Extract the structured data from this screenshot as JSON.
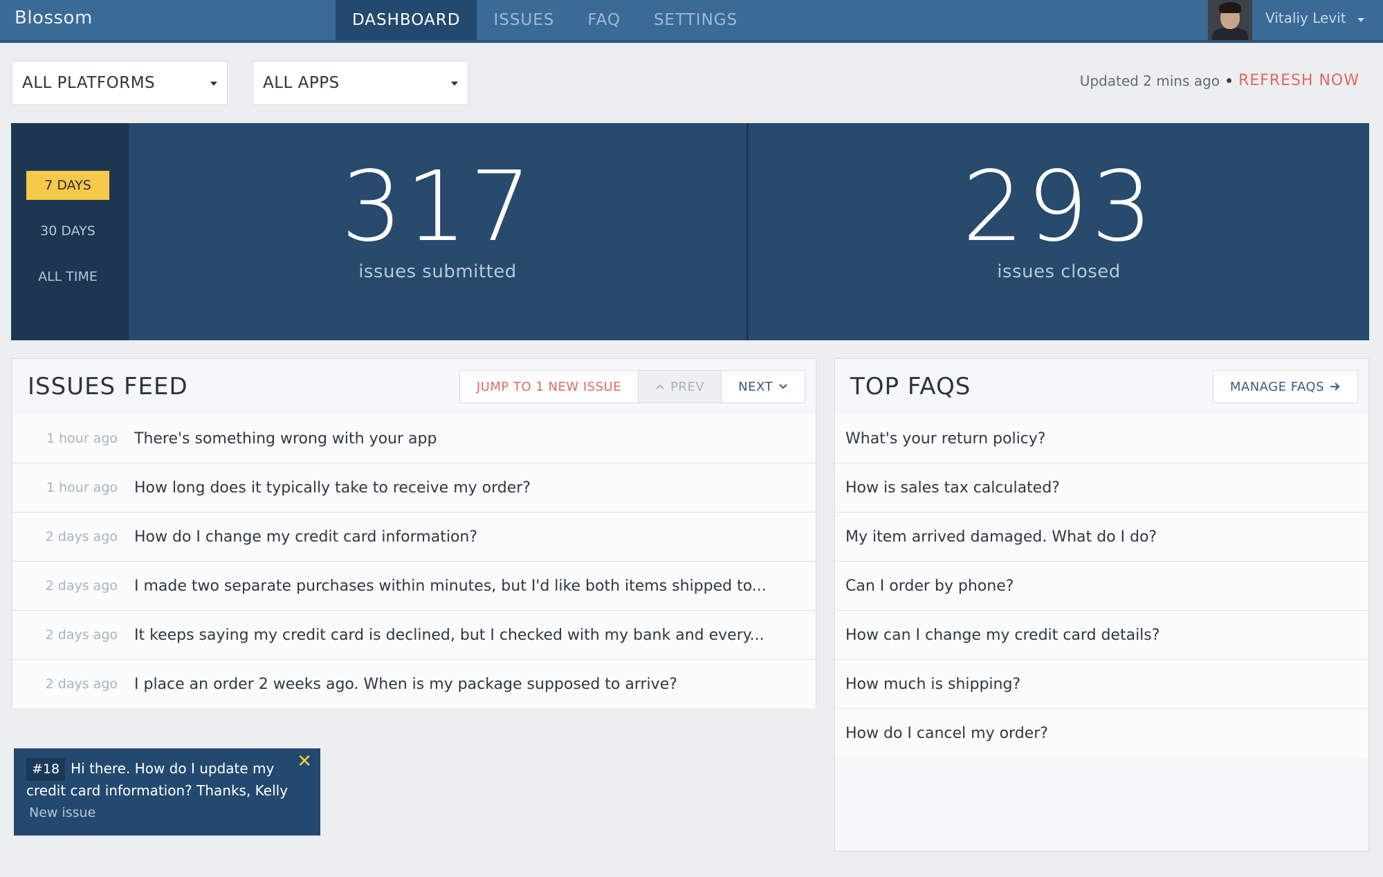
{
  "app": {
    "name": "Blossom"
  },
  "nav": {
    "tabs": [
      {
        "label": "DASHBOARD",
        "active": true
      },
      {
        "label": "ISSUES"
      },
      {
        "label": "FAQ"
      },
      {
        "label": "SETTINGS"
      }
    ]
  },
  "user": {
    "name": "Vitaliy Levit"
  },
  "filters": {
    "platform": "ALL PLATFORMS",
    "app": "ALL APPS",
    "updated_text": "Updated 2 mins ago",
    "refresh_label": "REFRESH NOW"
  },
  "ranges": [
    {
      "label": "7 DAYS",
      "active": true
    },
    {
      "label": "30 DAYS"
    },
    {
      "label": "ALL TIME"
    }
  ],
  "stats": {
    "submitted": {
      "value": "317",
      "label": "issues submitted"
    },
    "closed": {
      "value": "293",
      "label": "issues closed"
    }
  },
  "issues_feed": {
    "title": "ISSUES FEED",
    "jump_label": "JUMP TO 1 NEW ISSUE",
    "prev_label": "PREV",
    "next_label": "NEXT",
    "items": [
      {
        "time": "1 hour ago",
        "text": "There's something wrong with your app"
      },
      {
        "time": "1 hour ago",
        "text": "How long does it typically take to receive my order?"
      },
      {
        "time": "2 days ago",
        "text": "How do I change my credit card information?"
      },
      {
        "time": "2 days ago",
        "text": "I made two separate purchases within minutes, but I'd like both items shipped to..."
      },
      {
        "time": "2 days ago",
        "text": "It keeps saying my credit card is declined, but I checked with my bank and every..."
      },
      {
        "time": "2 days ago",
        "text": "I place an order 2 weeks ago. When is my package supposed to arrive?"
      }
    ]
  },
  "top_faqs": {
    "title": "TOP FAQS",
    "manage_label": "MANAGE FAQS",
    "items": [
      "What's your return policy?",
      "How is sales tax calculated?",
      "My item arrived damaged. What do I do?",
      "Can I order by phone?",
      "How can I change my credit card details?",
      "How much is shipping?",
      "How do I cancel my order?"
    ]
  },
  "toast": {
    "number": "#18",
    "message": "Hi there. How do I update my credit card information? Thanks, Kelly",
    "status": "New issue"
  },
  "colors": {
    "nav_bg": "#3a6a96",
    "nav_active": "#23496e",
    "stats_bg": "#274a6d",
    "range_active": "#f6c94c",
    "accent_red": "#e06a5c"
  }
}
